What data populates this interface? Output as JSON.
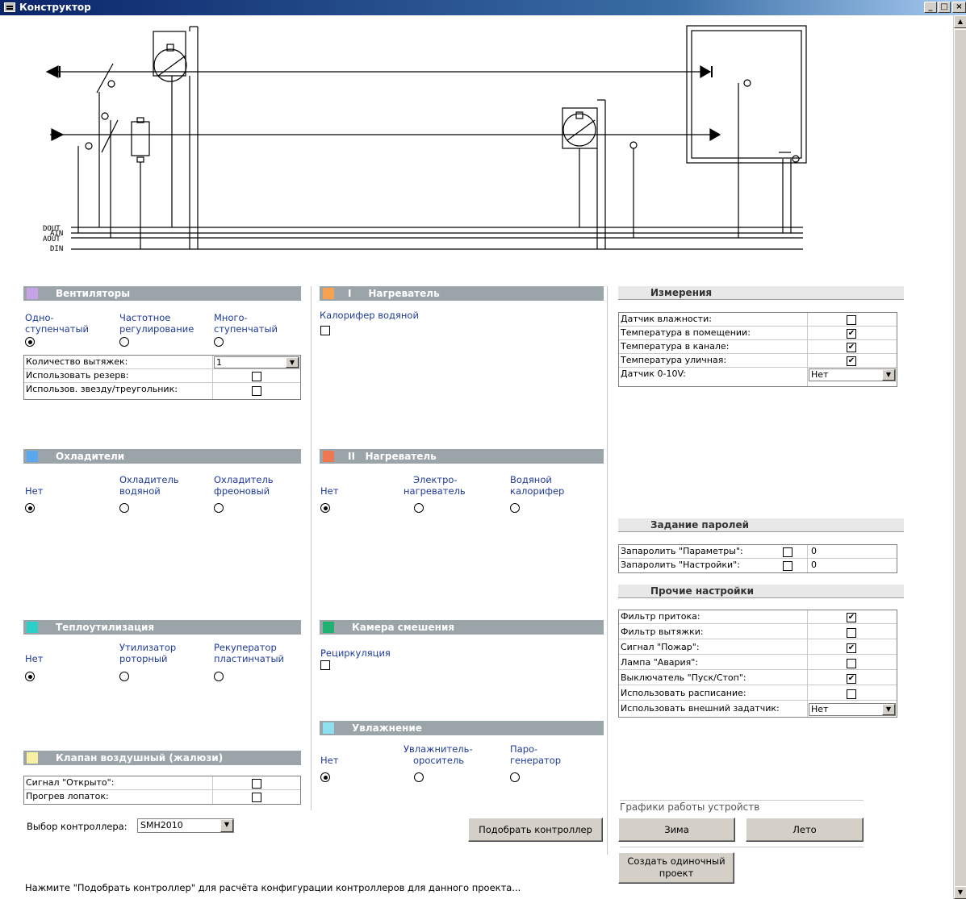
{
  "window": {
    "title": "Конструктор",
    "min_label": "_",
    "max_label": "□",
    "close_label": "×"
  },
  "schema": {
    "bus_labels": [
      "DOUT",
      "AIN",
      "AOUT",
      "DIN"
    ]
  },
  "fans": {
    "title": "Вентиляторы",
    "color": "#c6a2e8",
    "options": [
      {
        "line1": "Одно-",
        "line2": "ступенчатый",
        "selected": true
      },
      {
        "line1": "Частотное",
        "line2": "регулирование",
        "selected": false
      },
      {
        "line1": "Много-",
        "line2": "ступенчатый",
        "selected": false
      }
    ],
    "rows": [
      {
        "label": "Количество вытяжек:",
        "value": "1"
      },
      {
        "label": "Использовать резерв:",
        "checked": false
      },
      {
        "label": "Использов. звезду/треугольник:",
        "checked": false
      }
    ]
  },
  "heater1": {
    "title": "I     Нагреватель",
    "color": "#f6a350",
    "option_label": "Калорифер водяной",
    "checked": false
  },
  "coolers": {
    "title": "Охладители",
    "color": "#5aa8f0",
    "options": [
      {
        "line1": "",
        "line2": "Нет",
        "selected": true
      },
      {
        "line1": "Охладитель",
        "line2": "водяной",
        "selected": false
      },
      {
        "line1": "Охладитель",
        "line2": "фреоновый",
        "selected": false
      }
    ]
  },
  "heater2": {
    "title": "II   Нагреватель",
    "color": "#f07850",
    "options": [
      {
        "line1": "",
        "line2": "Нет",
        "selected": true
      },
      {
        "line1": "Электро-",
        "line2": "нагреватель",
        "selected": false
      },
      {
        "line1": "Водяной",
        "line2": "калорифер",
        "selected": false
      }
    ]
  },
  "heatrec": {
    "title": "Теплоутилизация",
    "color": "#2ad0c8",
    "options": [
      {
        "line1": "",
        "line2": "Нет",
        "selected": true
      },
      {
        "line1": "Утилизатор",
        "line2": "роторный",
        "selected": false
      },
      {
        "line1": "Рекуператор",
        "line2": "пластинчатый",
        "selected": false
      }
    ]
  },
  "mixing": {
    "title": "Камера смешения",
    "color": "#20b070",
    "option_label": "Рециркуляция",
    "checked": false
  },
  "humid": {
    "title": "Увлажнение",
    "color": "#8ee0f0",
    "options": [
      {
        "line1": "",
        "line2": "Нет",
        "selected": true
      },
      {
        "line1": "Увлажнитель-",
        "line2": "ороситель",
        "selected": false
      },
      {
        "line1": "Паро-",
        "line2": "генератор",
        "selected": false
      }
    ]
  },
  "valve": {
    "title": "Клапан воздушный (жалюзи)",
    "color": "#f8f0a0",
    "rows": [
      {
        "label": "Сигнал \"Открыто\":",
        "checked": false
      },
      {
        "label": "Прогрев лопаток:",
        "checked": false
      }
    ]
  },
  "measure": {
    "title": "Измерения",
    "rows": [
      {
        "label": "Датчик влажности:",
        "checked": false,
        "mark": ""
      },
      {
        "label": "Температура в помещении:",
        "checked": true,
        "mark": "✔"
      },
      {
        "label": "Температура в канале:",
        "checked": true,
        "mark": "✔"
      },
      {
        "label": "Температура уличная:",
        "checked": true,
        "mark": "✔"
      },
      {
        "label": "Датчик 0-10V:",
        "value": "Нет"
      }
    ]
  },
  "passwords": {
    "title": "Задание паролей",
    "rows": [
      {
        "label": "Запаролить \"Параметры\":",
        "checked": false,
        "value": "0"
      },
      {
        "label": "Запаролить \"Настройки\":",
        "checked": false,
        "value": "0"
      }
    ]
  },
  "other": {
    "title": "Прочие настройки",
    "rows": [
      {
        "label": "Фильтр притока:",
        "checked": true,
        "mark": "✔"
      },
      {
        "label": "Фильтр вытяжки:",
        "checked": false,
        "mark": ""
      },
      {
        "label": "Сигнал \"Пожар\":",
        "checked": true,
        "mark": "✔"
      },
      {
        "label": "Лампа \"Авария\":",
        "checked": false,
        "mark": ""
      },
      {
        "label": "Выключатель \"Пуск/Стоп\":",
        "checked": true,
        "mark": "✔"
      },
      {
        "label": "Использовать расписание:",
        "checked": false,
        "mark": ""
      },
      {
        "label": "Использовать внешний задатчик:",
        "value": "Нет"
      }
    ]
  },
  "controller": {
    "label": "Выбор контроллера:",
    "value": "SMH2010",
    "pick_button": "Подобрать контроллер"
  },
  "schedules": {
    "title": "Графики работы устройств",
    "winter": "Зима",
    "summer": "Лето",
    "single_project": "Создать одиночный проект"
  },
  "status": "Нажмите \"Подобрать контроллер\" для расчёта конфигурации контроллеров для данного проекта..."
}
